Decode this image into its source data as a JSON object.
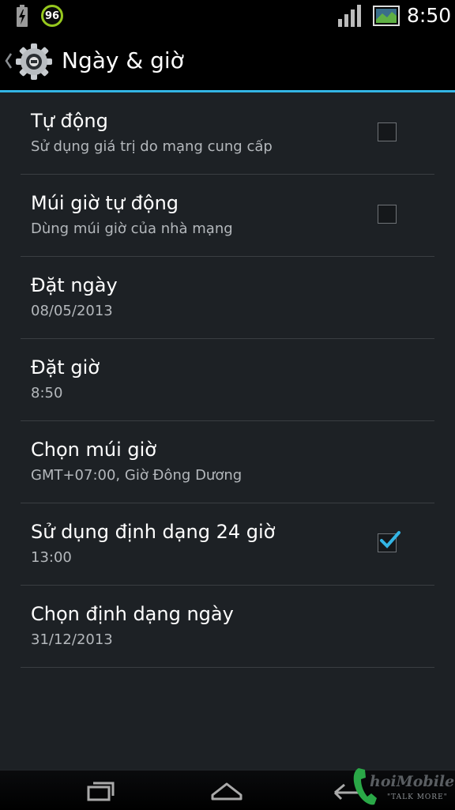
{
  "status_bar": {
    "battery_level": "96",
    "time": "8:50"
  },
  "action_bar": {
    "title": "Ngày & giờ"
  },
  "settings": [
    {
      "title": "Tự động",
      "summary": "Sử dụng giá trị do mạng cung cấp",
      "checkbox": true,
      "checked": false
    },
    {
      "title": "Múi giờ tự động",
      "summary": "Dùng múi giờ của nhà mạng",
      "checkbox": true,
      "checked": false
    },
    {
      "title": "Đặt ngày",
      "summary": "08/05/2013",
      "checkbox": false
    },
    {
      "title": "Đặt giờ",
      "summary": "8:50",
      "checkbox": false
    },
    {
      "title": "Chọn múi giờ",
      "summary": "GMT+07:00, Giờ Đông Dương",
      "checkbox": false
    },
    {
      "title": "Sử dụng định dạng 24 giờ",
      "summary": "13:00",
      "checkbox": true,
      "checked": true
    },
    {
      "title": "Chọn định dạng ngày",
      "summary": "31/12/2013",
      "checkbox": false
    }
  ],
  "watermark": {
    "name": "hoiMobile",
    "tagline": "\"TALK MORE\""
  },
  "colors": {
    "accent": "#33b5e5",
    "background": "#1d2125",
    "battery_ring": "#96c81e"
  },
  "icons": {
    "battery": "battery-charging-icon",
    "signal": "signal-strength-icon",
    "screenshot": "screenshot-notification-icon",
    "settings": "gear-icon",
    "recent": "recent-apps-icon",
    "home": "home-icon",
    "back": "back-icon"
  }
}
